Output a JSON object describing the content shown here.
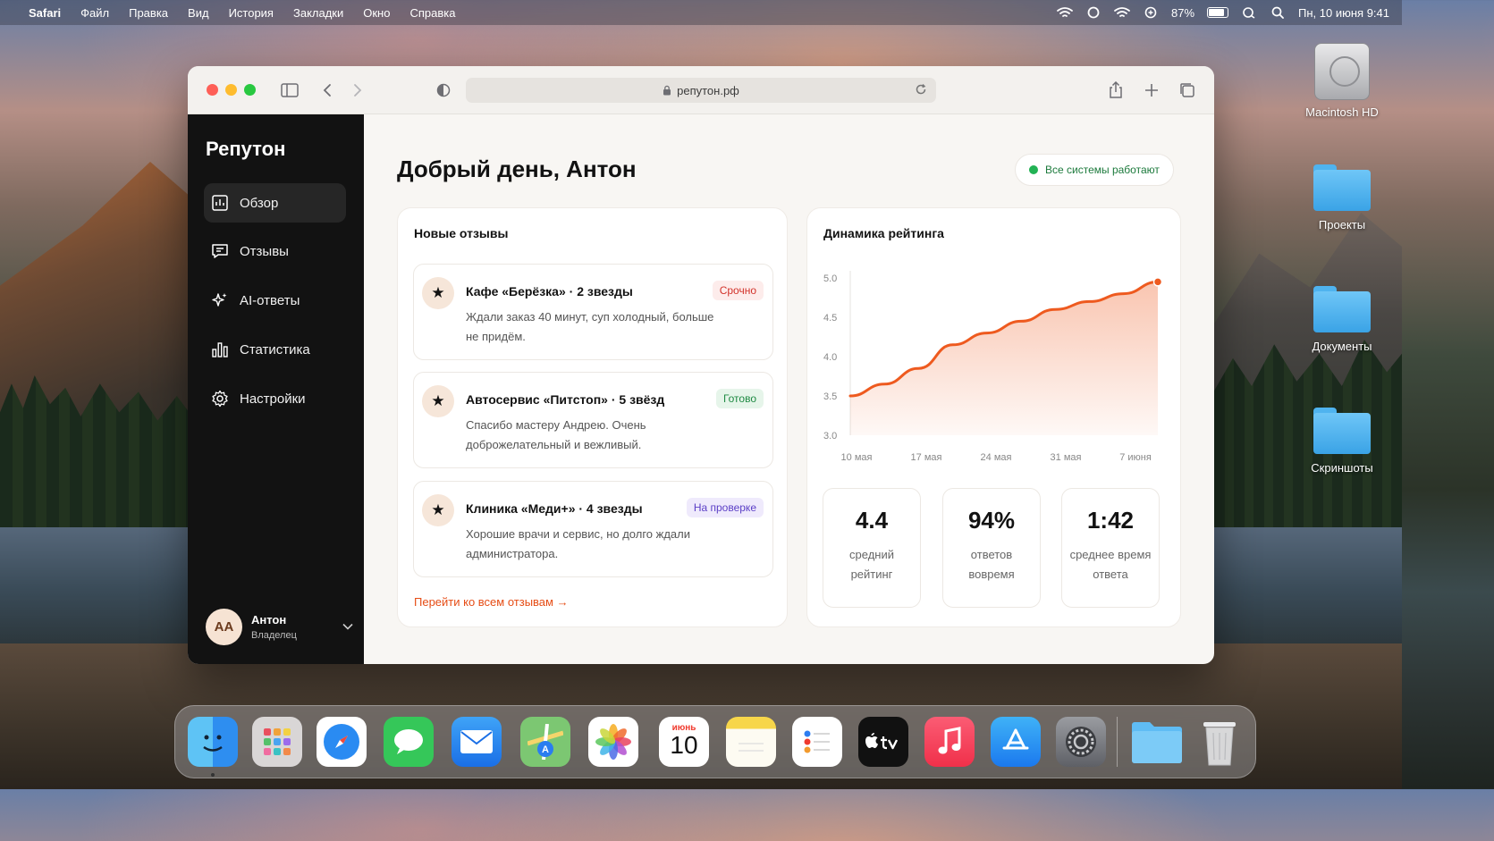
{
  "menubar": {
    "app": "Safari",
    "items": [
      "Файл",
      "Правка",
      "Вид",
      "История",
      "Закладки",
      "Окно",
      "Справка"
    ],
    "battery": "87%",
    "datetime": "Пн, 10 июня  9:41"
  },
  "desktop": {
    "icons": [
      {
        "label": "Macintosh HD",
        "icon": "hard-drive-icon"
      },
      {
        "label": "Проекты",
        "icon": "folder-icon"
      },
      {
        "label": "Документы",
        "icon": "folder-icon"
      },
      {
        "label": "Скриншоты",
        "icon": "folder-icon"
      }
    ]
  },
  "browser": {
    "url": "репутон.рф"
  },
  "sidebar": {
    "brand": "Репутон",
    "items": [
      {
        "label": "Обзор",
        "icon": "dashboard-icon",
        "active": true
      },
      {
        "label": "Отзывы",
        "icon": "chat-icon",
        "active": false
      },
      {
        "label": "AI-ответы",
        "icon": "ai-sparkle-icon",
        "active": false
      },
      {
        "label": "Статистика",
        "icon": "bar-chart-icon",
        "active": false
      },
      {
        "label": "Настройки",
        "icon": "gear-icon",
        "active": false
      }
    ],
    "user": {
      "initials": "АА",
      "name": "Антон",
      "role": "Владелец"
    }
  },
  "main": {
    "greeting": "Добрый день, Антон",
    "status": "Все системы работают",
    "reviews": {
      "title": "Новые отзывы",
      "items": [
        {
          "title": "Кафе «Берёзка» · 2 звезды",
          "text": "Ждали заказ 40 минут, суп холодный, больше не придём.",
          "badge": "Срочно"
        },
        {
          "title": "Автосервис «Питстоп» · 5 звёзд",
          "text": "Спасибо мастеру Андрею. Очень доброжелательный и вежливый.",
          "badge": "Готово"
        },
        {
          "title": "Клиника «Меди+» · 4 звезды",
          "text": "Хорошие врачи и сервис, но долго ждали администратора.",
          "badge": "На проверке"
        }
      ],
      "link": "Перейти ко всем отзывам →"
    },
    "rating": {
      "title": "Динамика рейтинга",
      "stats": [
        {
          "value": "4.4",
          "label": "средний рейтинг"
        },
        {
          "value": "94%",
          "label": "ответов вовремя"
        },
        {
          "value": "1:42",
          "label": "среднее время ответа"
        }
      ]
    }
  },
  "chart_data": {
    "type": "area",
    "title": "Динамика рейтинга",
    "x_ticks": [
      "10 мая",
      "17 мая",
      "24 мая",
      "31 мая",
      "7 июня"
    ],
    "y_ticks": [
      "3.0",
      "3.5",
      "4.0",
      "4.5",
      "5.0"
    ],
    "ylim": [
      3.0,
      5.0
    ],
    "x": [
      "10 мая",
      "14 мая",
      "17 мая",
      "21 мая",
      "24 мая",
      "28 мая",
      "31 мая",
      "4 июня",
      "7 июня",
      "10 июня"
    ],
    "values": [
      3.5,
      3.65,
      3.85,
      4.15,
      4.3,
      4.45,
      4.6,
      4.7,
      4.8,
      4.95
    ],
    "grid": false,
    "color": "#ee5a1f"
  },
  "dock": {
    "apps": [
      "finder-icon",
      "launchpad-icon",
      "safari-icon",
      "messages-icon",
      "mail-icon",
      "maps-icon",
      "photos-icon",
      "calendar-icon",
      "notes-icon",
      "reminders-icon",
      "apple-tv-icon",
      "music-icon",
      "app-store-icon",
      "system-settings-icon",
      "folder-icon",
      "trash-icon"
    ],
    "calendar_month": "июнь",
    "calendar_day": "10"
  }
}
